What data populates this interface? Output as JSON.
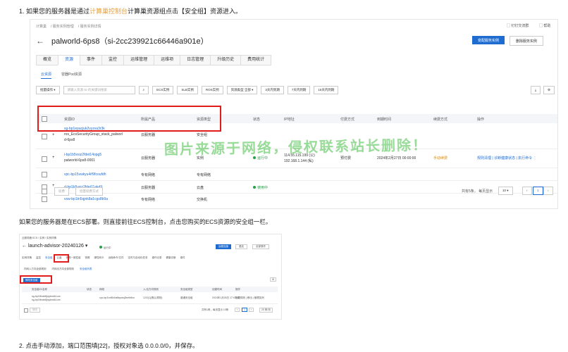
{
  "step1": {
    "prefix": "1. 如果您的服务器是通过",
    "highlight": "计算巢控制台",
    "suffix": "计算巢资源组点击【安全组】资源进入。"
  },
  "shot1": {
    "breadcrumb": [
      "计算巢",
      "服务实例管理",
      "服务实例详情"
    ],
    "top_actions": [
      "钉钉交流群",
      "帮助"
    ],
    "title": "palworld-6ps8（si-2cc239921c66446a901e）",
    "btn_primary": "变配服务实例",
    "btn_delete": "删除服务实例",
    "tabs": [
      "概览",
      "资源",
      "事件",
      "监控",
      "运维管理",
      "运维项",
      "日志管理",
      "升级历史",
      "费用统计"
    ],
    "subtabs": [
      "云资源",
      "容器Pod资源"
    ],
    "toolbar": {
      "batch": "批量操作",
      "search_placeholder": "请输入资源 ID 的关键词搜索",
      "f1": "ECS实例",
      "f2": "SLB实例",
      "f3": "ROS实例",
      "type": "资源类型  全部",
      "d1": "3天内到期",
      "d2": "7天内到期",
      "d3": "15天内到期"
    },
    "headers": [
      "资源ID",
      "所属产品",
      "资源类型",
      "状态",
      "IP地址",
      "付费方式",
      "到期时间",
      "续费方式",
      "操作"
    ],
    "rows": [
      {
        "id": "sg-bp1epacjuk2vyzva3r3k",
        "id2": "ros_EcsSecurityGroup_stack_palworl",
        "id3": "d-6ps8",
        "product": "云服务器",
        "type": "安全组",
        "status": "",
        "ip": "",
        "ip2": "",
        "pay": "",
        "expire": "",
        "renew": "",
        "ops": ""
      },
      {
        "id": "i-bp1b5vsiz2fdet14opg5",
        "id2": "palworld-6ps8-0001",
        "product": "云服务器",
        "type": "实例",
        "status": "运行中",
        "ip": "114.55.115.199 (公)",
        "ip2": "192.168.1.144 (私)",
        "pay": "预付费",
        "expire": "2024年2月27日 00:00:00",
        "renew": "手动续费",
        "ops": "规则清理 | 诊断健康状态 | 执行命令 ⋮"
      },
      {
        "id": "vpc-bp15vwkyu4rf9fcoufdh",
        "product": "专有网络",
        "type": "专有网络"
      },
      {
        "id": "d-bp1b5vsiz2fdet11akd9",
        "product": "云服务器",
        "type": "云盘",
        "status": "使用中"
      },
      {
        "id": "vsw-bp1tn5qjnk8a1cgs8b9a",
        "product": "专有网络",
        "type": "交换机"
      }
    ],
    "footer": {
      "b1": "续费",
      "b2": "批量续费方式",
      "total": "共有5条， 每页显示",
      "per": "10",
      "page": "1"
    },
    "watermark": "图片来源于网络，侵权联系站长删除！"
  },
  "para2": "如果您的服务器是在ECS部署。则直接前往ECS控制台，点击您购买的ECS资源的安全组一栏。",
  "shot2": {
    "crumb": "云服务器 ECS  /  实例  /  实例详情",
    "title": "launch-advisor-20240126",
    "status": "运行中",
    "btns": [
      "远程连接",
      "重启",
      "全部操作"
    ],
    "tabs": [
      "实例详情",
      "监控",
      "安全组",
      "云盘",
      "快照一致性组",
      "快照",
      "弹性网卡",
      "远程命令/文件",
      "定时与自动化任务",
      "操作记录",
      "健康诊断",
      "事件"
    ],
    "subtabs": [
      "内网入方向全部规则",
      "内网出方向全部规则",
      "安全组列表"
    ],
    "add_btn": "修改安全组",
    "headers": [
      "安全组ID/名称",
      "状态",
      "网络",
      "入/出方向规则",
      "安全组类型",
      "创建时间",
      "操作"
    ],
    "rows": [
      {
        "id": "sg-bp18mxb8jrqdnrdk1um",
        "name": "sg-bp18mxb8jrqdnrdk1um",
        "net": "vpc-bp1vxt8c4a6fqzwq2kmb8nu",
        "rule": "12/2(1)(默认规则)",
        "type": "普通安全组",
        "created": "2024年1月26日 17:03:41",
        "ops": "配置规则 | 移出 | 管理实例"
      },
      {
        "id": "sg-bp18mxb8jrqdnrdk1um",
        "name": "sg-bp18mxb8jrqdnrdk1um",
        "net": "",
        "rule": "",
        "type": "",
        "created": "",
        "ops": ""
      }
    ],
    "footer": {
      "b": "修改",
      "total": "共有1条，每页显示 10条",
      "page": "1",
      "per": "20 条/页"
    }
  },
  "step2": "2. 点击手动添加，端口范围填[22]，授权对象选 0.0.0.0/0，并保存。"
}
